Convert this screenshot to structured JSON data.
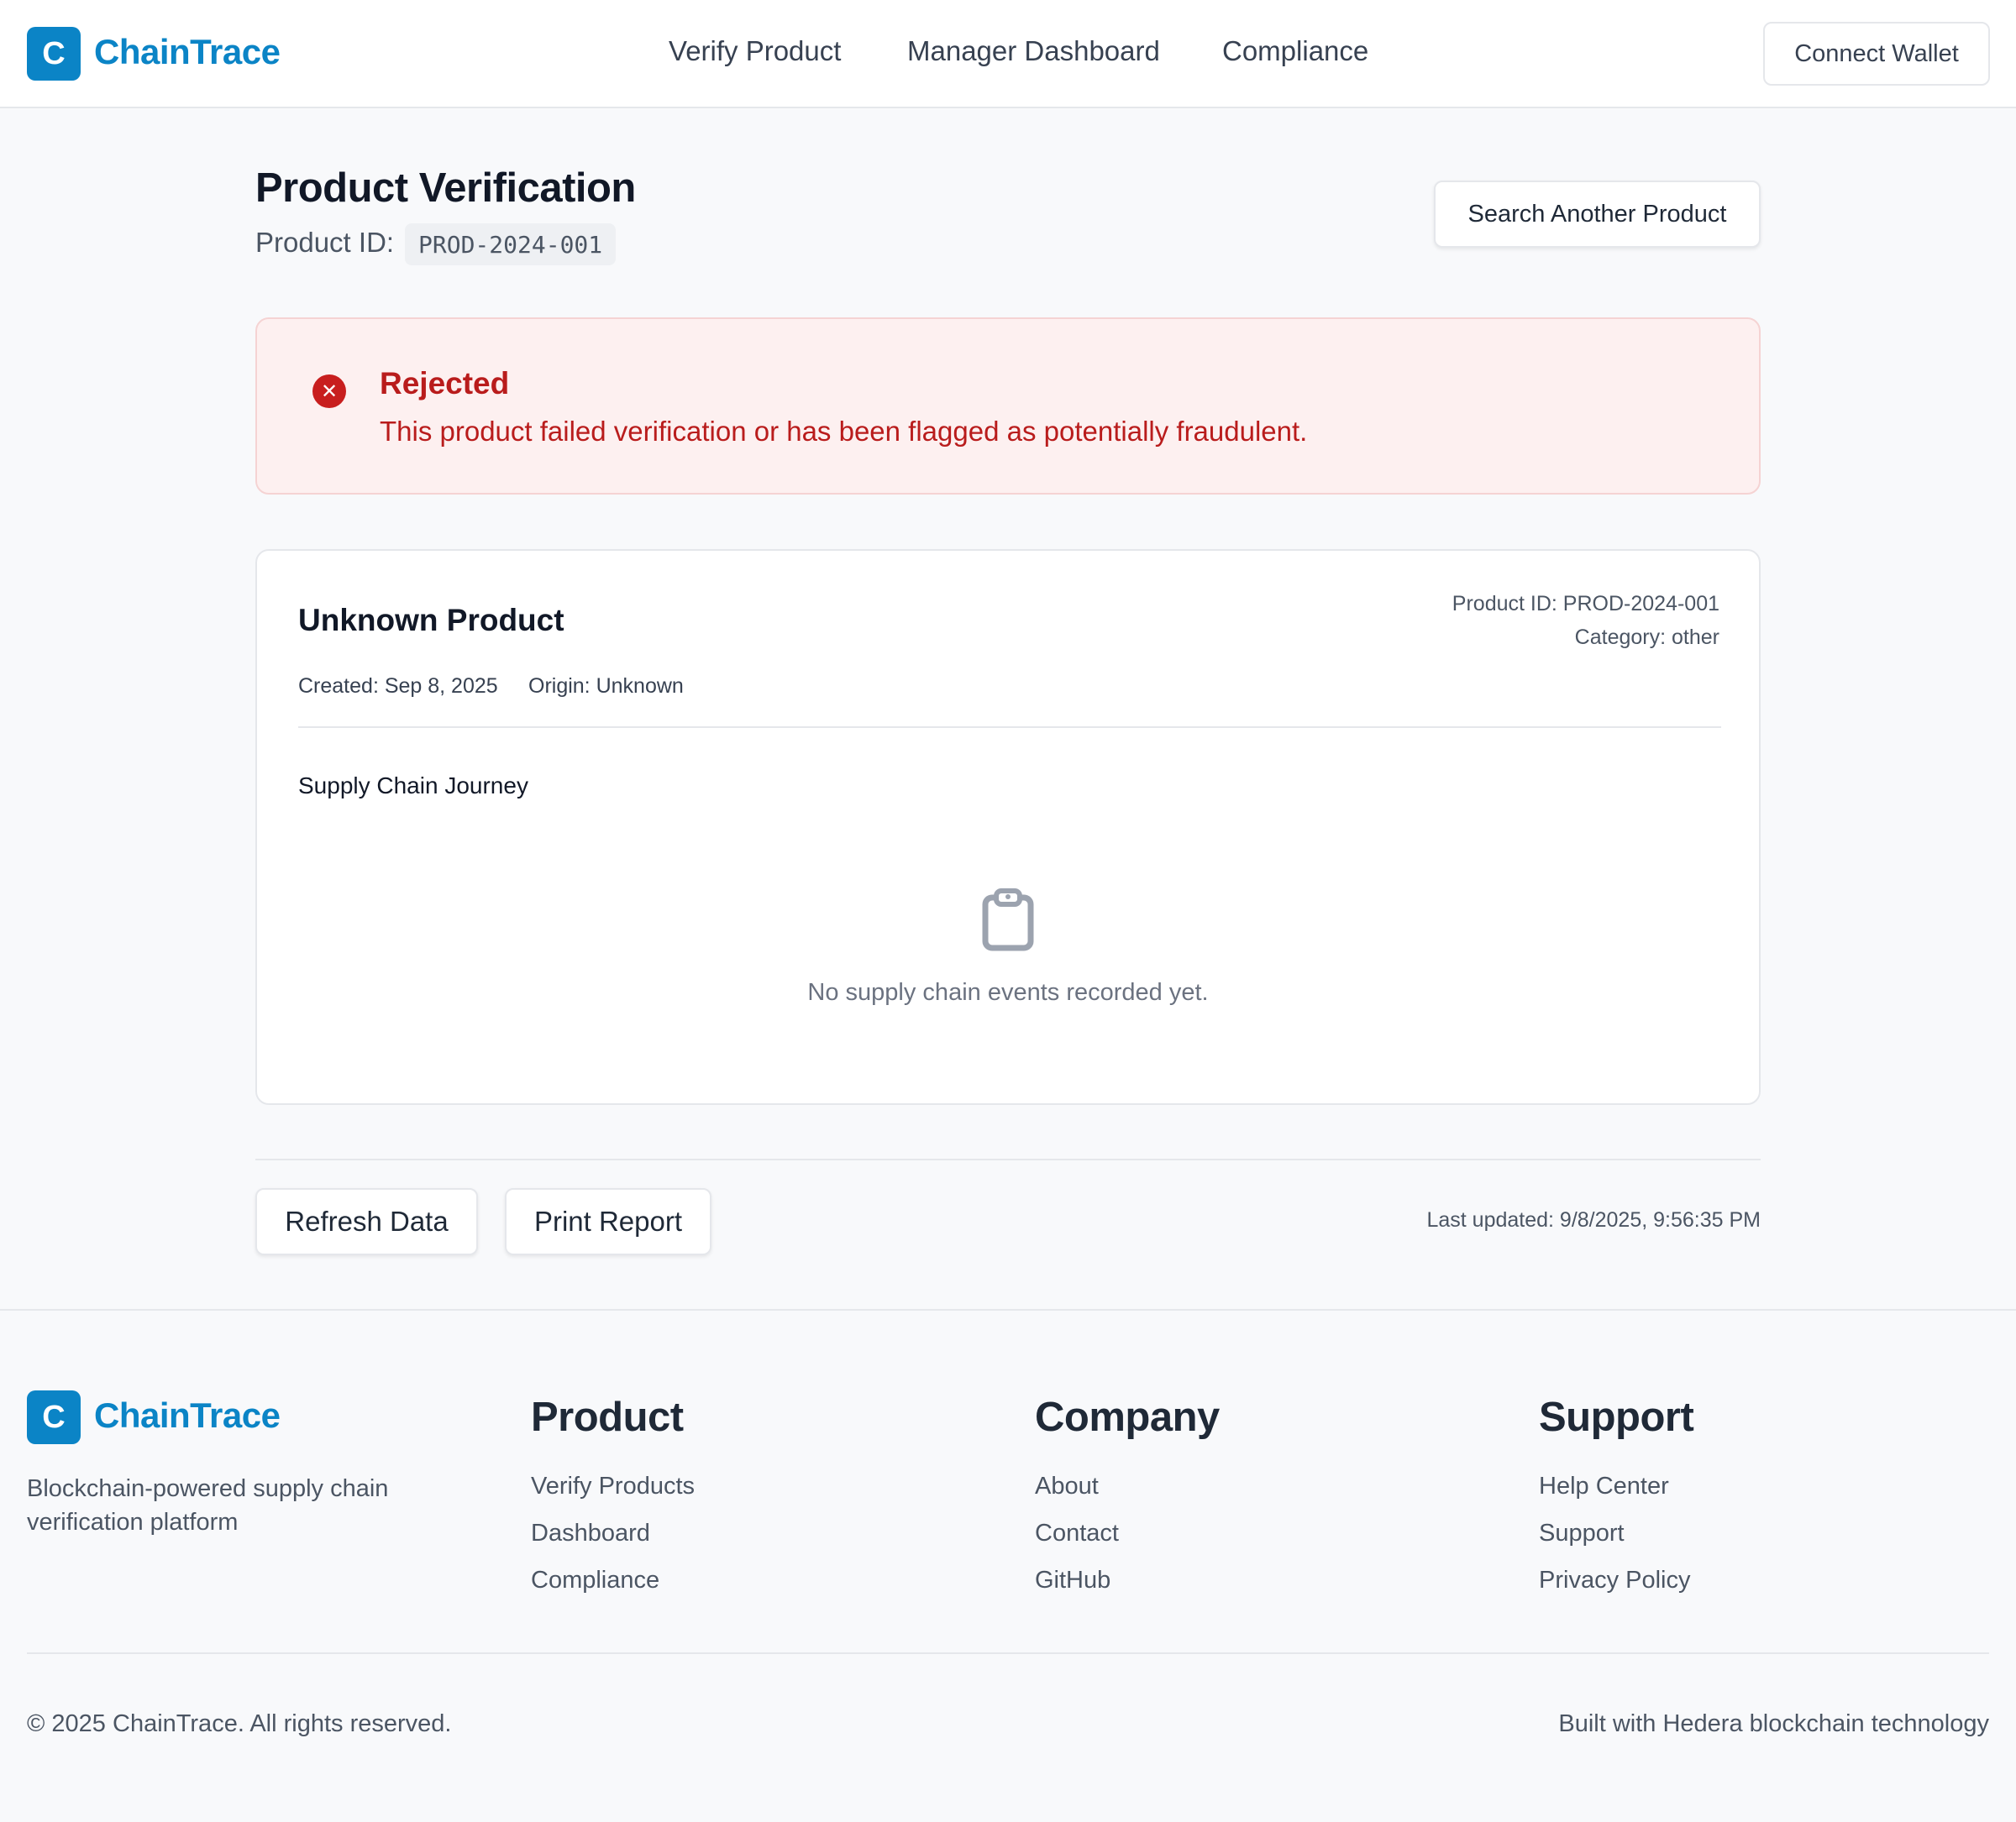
{
  "header": {
    "logo_letter": "C",
    "brand": "ChainTrace",
    "nav": [
      "Verify Product",
      "Manager Dashboard",
      "Compliance"
    ],
    "connect_wallet": "Connect Wallet"
  },
  "page": {
    "title": "Product Verification",
    "product_id_label": "Product ID:",
    "product_id": "PROD-2024-001",
    "search_another": "Search Another Product"
  },
  "alert": {
    "icon": "x-circle-icon",
    "title": "Rejected",
    "message": "This product failed verification or has been flagged as potentially fraudulent.",
    "color": "#b91c1c"
  },
  "product_card": {
    "name": "Unknown Product",
    "created": "Created: Sep 8, 2025",
    "origin": "Origin: Unknown",
    "product_id": "Product ID: PROD-2024-001",
    "category": "Category: other",
    "journey_title": "Supply Chain Journey",
    "empty_icon": "clipboard-icon",
    "empty_message": "No supply chain events recorded yet."
  },
  "actions": {
    "refresh": "Refresh Data",
    "print": "Print Report",
    "last_updated": "Last updated: 9/8/2025, 9:56:35 PM"
  },
  "footer": {
    "logo_letter": "C",
    "brand": "ChainTrace",
    "description": "Blockchain-powered supply chain verification platform",
    "columns": [
      {
        "heading": "Product",
        "links": [
          "Verify Products",
          "Dashboard",
          "Compliance"
        ]
      },
      {
        "heading": "Company",
        "links": [
          "About",
          "Contact",
          "GitHub"
        ]
      },
      {
        "heading": "Support",
        "links": [
          "Help Center",
          "Support",
          "Privacy Policy"
        ]
      }
    ],
    "copyright": "© 2025 ChainTrace. All rights reserved.",
    "built_with": "Built with Hedera blockchain technology"
  },
  "colors": {
    "brand": "#0b84c6",
    "danger": "#c81e1e",
    "background": "#f8f9fb"
  }
}
